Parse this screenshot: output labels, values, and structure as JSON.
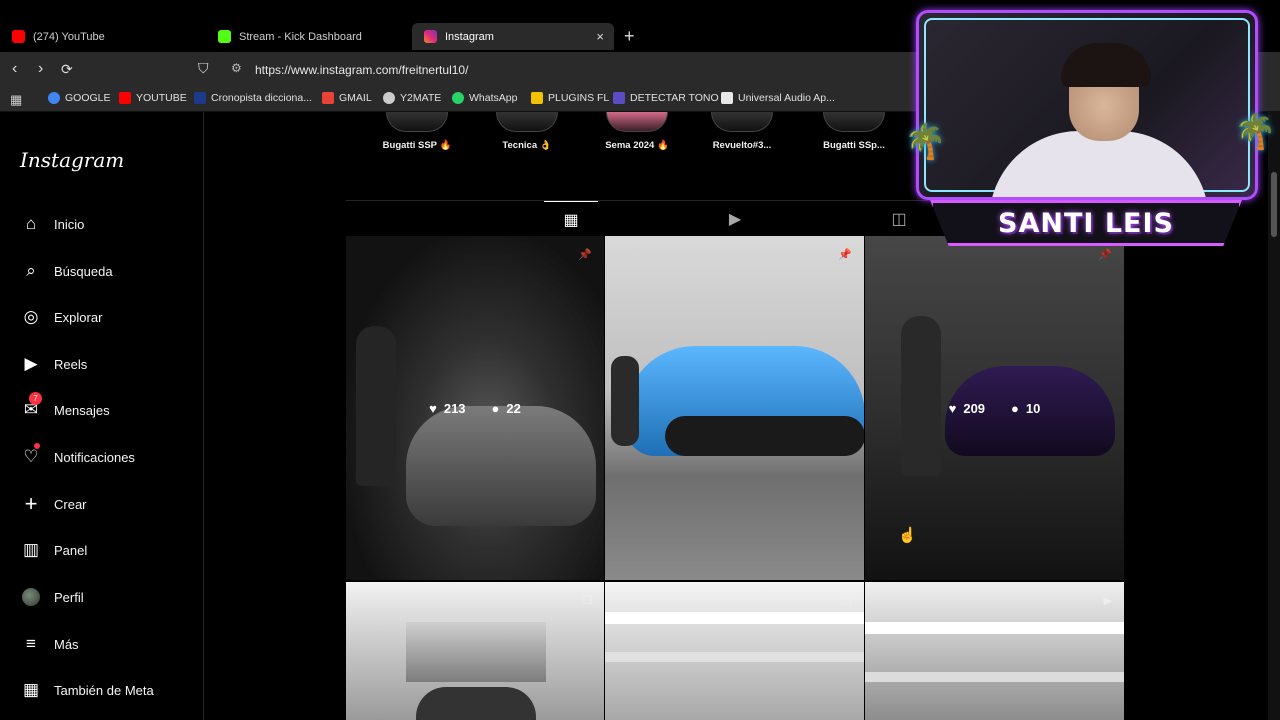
{
  "browser": {
    "tabs": [
      {
        "label": "(274) YouTube",
        "color": "#ff0000"
      },
      {
        "label": "Stream - Kick Dashboard",
        "color": "#53fc18"
      },
      {
        "label": "Instagram",
        "color": "#e1306c"
      }
    ],
    "new_tab": "+",
    "close_tab": "×",
    "url": "https://www.instagram.com/freitnertul10/",
    "bookmarks": [
      {
        "label": "GOOGLE",
        "color": "#4285f4"
      },
      {
        "label": "YOUTUBE",
        "color": "#ff0000"
      },
      {
        "label": "Cronopista dicciona...",
        "color": "#1e3a8a"
      },
      {
        "label": "GMAIL",
        "color": "#ea4335"
      },
      {
        "label": "Y2MATE",
        "color": "#cccccc"
      },
      {
        "label": "WhatsApp",
        "color": "#25d366"
      },
      {
        "label": "PLUGINS FL",
        "color": "#f2c200"
      },
      {
        "label": "DETECTAR TONO",
        "color": "#5b4cc4"
      },
      {
        "label": "Universal Audio Ap...",
        "color": "#e8e8e8"
      }
    ]
  },
  "sidebar": {
    "logo": "Instagram",
    "items": [
      {
        "label": "Inicio",
        "icon": "home-icon"
      },
      {
        "label": "Búsqueda",
        "icon": "search-icon"
      },
      {
        "label": "Explorar",
        "icon": "compass-icon"
      },
      {
        "label": "Reels",
        "icon": "reels-icon"
      },
      {
        "label": "Mensajes",
        "icon": "messenger-icon",
        "badge": "7"
      },
      {
        "label": "Notificaciones",
        "icon": "heart-icon"
      },
      {
        "label": "Crear",
        "icon": "plus-icon"
      },
      {
        "label": "Panel",
        "icon": "chart-icon"
      },
      {
        "label": "Perfil",
        "icon": "avatar"
      },
      {
        "label": "Más",
        "icon": "menu-icon"
      },
      {
        "label": "También de Meta",
        "icon": "meta-icon"
      }
    ]
  },
  "highlights": [
    {
      "label": "Bugatti SSP 🔥"
    },
    {
      "label": "Tecnica 👌"
    },
    {
      "label": "Sema 2024 🔥"
    },
    {
      "label": "Revuelto#3..."
    },
    {
      "label": "Bugatti SSp..."
    }
  ],
  "posts": [
    {
      "likes": "213",
      "comments": "22",
      "hover": true
    },
    {
      "likes": "",
      "comments": "",
      "hover": false
    },
    {
      "likes": "209",
      "comments": "10",
      "hover": true
    }
  ],
  "webcam": {
    "name": "SANTI LEIS"
  },
  "colors": {
    "accent_purple": "#b24cff",
    "accent_cyan": "#8ee6ff",
    "badge_red": "#ff3040"
  }
}
